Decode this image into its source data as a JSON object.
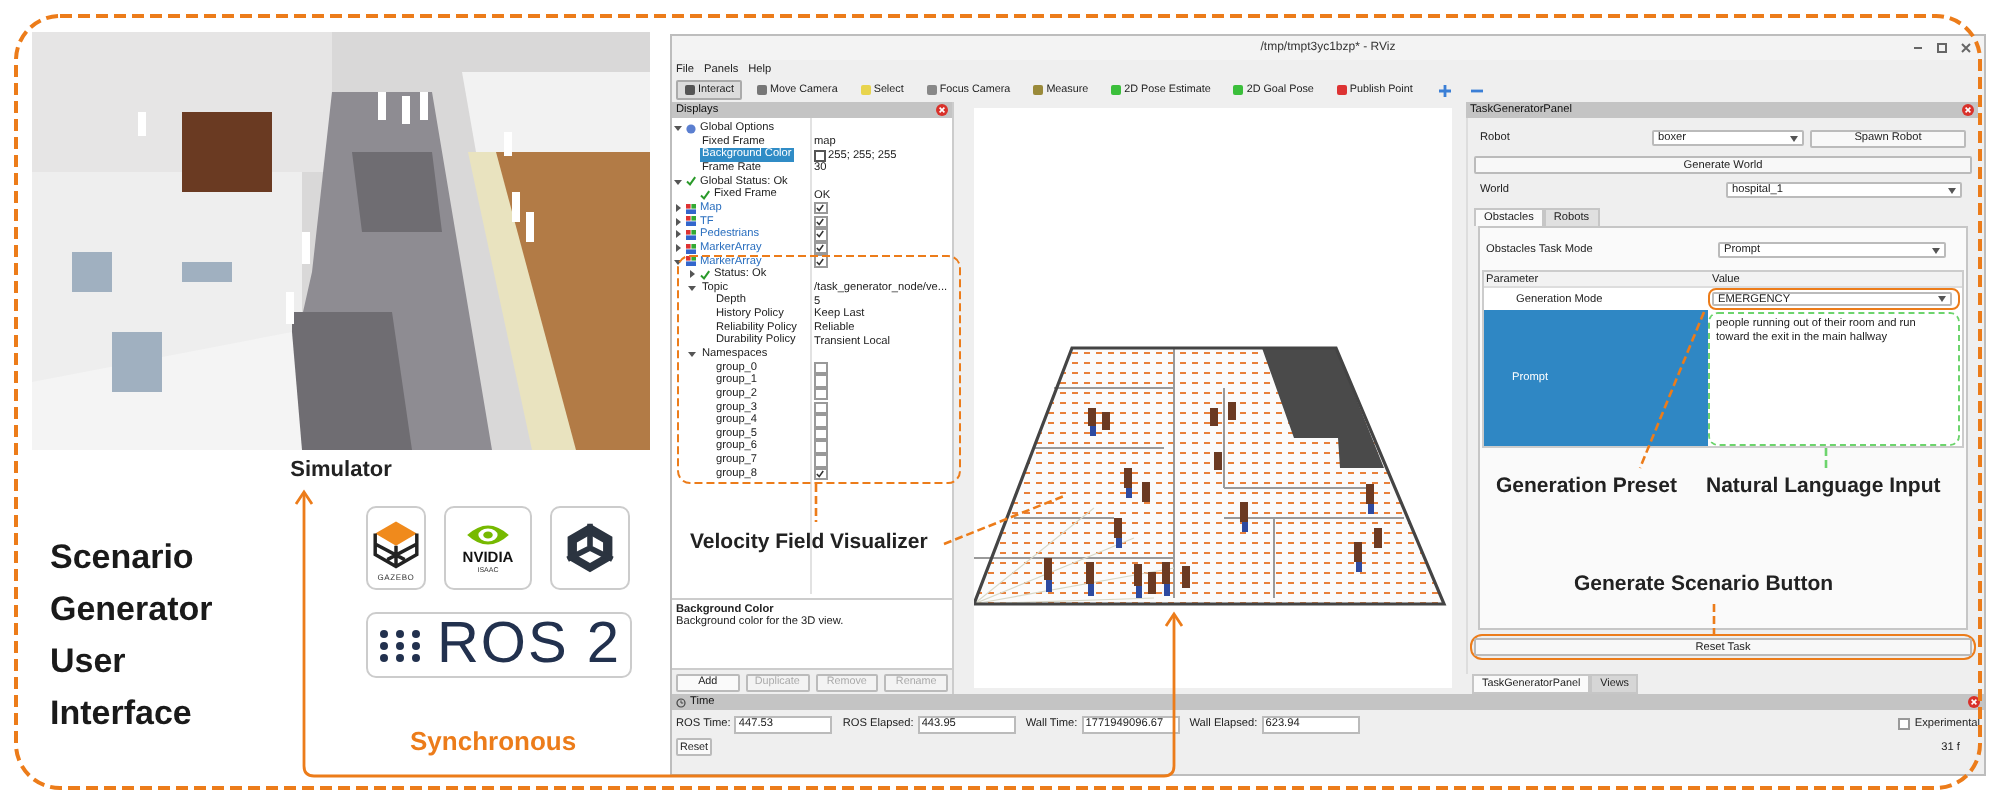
{
  "simulator": {
    "kind": "picture",
    "caption": "Simulator"
  },
  "heading": "Scenario Generator User Interface",
  "logos": [
    {
      "kind": "gazebo",
      "text": "GAZEBO"
    },
    {
      "kind": "nvidia",
      "text": "NVIDIA",
      "subtext": "ISAAC"
    },
    {
      "kind": "unity"
    },
    {
      "kind": "ros",
      "text": "ROS 2"
    }
  ],
  "sync_label": "Synchronous",
  "rviz": {
    "title": "/tmp/tmpt3yc1bzp* - RViz",
    "menu": [
      "File",
      "Panels",
      "Help"
    ],
    "toolbar": [
      {
        "label": "Interact",
        "selected": true
      },
      {
        "label": "Move Camera",
        "selected": false
      },
      {
        "label": "Select",
        "selected": false
      },
      {
        "label": "Focus Camera",
        "selected": false
      },
      {
        "label": "Measure",
        "selected": false
      },
      {
        "label": "2D Pose Estimate",
        "selected": false
      },
      {
        "label": "2D Goal Pose",
        "selected": false
      },
      {
        "label": "Publish Point",
        "selected": false
      }
    ],
    "displays": {
      "title": "Displays",
      "tree": [
        {
          "kind": "options",
          "name": "Global Options",
          "expanded": true,
          "selected": false,
          "children": [
            {
              "kind": "property",
              "name": "Fixed Frame",
              "value": "map",
              "selected": false
            },
            {
              "kind": "color",
              "name": "Background Color",
              "value": "255; 255; 255",
              "selected": true
            },
            {
              "kind": "property",
              "name": "Frame Rate",
              "value": "30",
              "selected": false
            }
          ]
        },
        {
          "kind": "status",
          "name": "Global Status: Ok",
          "expanded": true,
          "selected": false,
          "children": [
            {
              "kind": "status",
              "name": "Fixed Frame",
              "value": "OK",
              "selected": false
            }
          ]
        },
        {
          "kind": "display",
          "name": "Map",
          "expanded": false,
          "checked": true,
          "selected": false
        },
        {
          "kind": "display",
          "name": "TF",
          "expanded": false,
          "checked": true,
          "selected": false
        },
        {
          "kind": "display",
          "name": "Pedestrians",
          "expanded": false,
          "checked": true,
          "selected": false
        },
        {
          "kind": "display",
          "name": "MarkerArray",
          "expanded": false,
          "checked": true,
          "selected": false
        },
        {
          "kind": "display",
          "name": "MarkerArray",
          "expanded": true,
          "checked": true,
          "selected": false,
          "children": [
            {
              "kind": "status",
              "name": "Status: Ok",
              "expanded": false,
              "selected": false
            },
            {
              "kind": "property",
              "name": "Topic",
              "value": "/task_generator_node/ve...",
              "expanded": true,
              "selected": false,
              "children": [
                {
                  "kind": "property",
                  "name": "Depth",
                  "value": "5",
                  "selected": false
                },
                {
                  "kind": "property",
                  "name": "History Policy",
                  "value": "Keep Last",
                  "selected": false
                },
                {
                  "kind": "property",
                  "name": "Reliability Policy",
                  "value": "Reliable",
                  "selected": false
                },
                {
                  "kind": "property",
                  "name": "Durability Policy",
                  "value": "Transient Local",
                  "selected": false
                }
              ]
            },
            {
              "kind": "property",
              "name": "Namespaces",
              "expanded": true,
              "selected": false,
              "children": [
                {
                  "kind": "property",
                  "name": "group_0",
                  "checked": false,
                  "selected": false
                },
                {
                  "kind": "property",
                  "name": "group_1",
                  "checked": false,
                  "selected": false
                },
                {
                  "kind": "property",
                  "name": "group_2",
                  "checked": false,
                  "selected": false
                },
                {
                  "kind": "property",
                  "name": "group_3",
                  "checked": false,
                  "selected": false
                },
                {
                  "kind": "property",
                  "name": "group_4",
                  "checked": false,
                  "selected": false
                },
                {
                  "kind": "property",
                  "name": "group_5",
                  "checked": false,
                  "selected": false
                },
                {
                  "kind": "property",
                  "name": "group_6",
                  "checked": false,
                  "selected": false
                },
                {
                  "kind": "property",
                  "name": "group_7",
                  "checked": false,
                  "selected": false
                },
                {
                  "kind": "property",
                  "name": "group_8",
                  "checked": true,
                  "selected": false
                }
              ]
            }
          ]
        }
      ],
      "description": {
        "title": "Background Color",
        "text": "Background color for the 3D view."
      },
      "buttons": [
        {
          "label": "Add",
          "disabled": false
        },
        {
          "label": "Duplicate",
          "disabled": true
        },
        {
          "label": "Remove",
          "disabled": true
        },
        {
          "label": "Rename",
          "disabled": true
        }
      ]
    },
    "viewport": {
      "kind": "picture"
    },
    "task_panel": {
      "title": "TaskGeneratorPanel",
      "robot_label": "Robot",
      "robot": "boxer",
      "spawn_button": "Spawn Robot",
      "generate_world_button": "Generate World",
      "world_label": "World",
      "world": "hospital_1",
      "tabs": [
        {
          "label": "Obstacles",
          "selected": true
        },
        {
          "label": "Robots",
          "selected": false
        }
      ],
      "task_mode_label": "Obstacles Task Mode",
      "task_mode": "Prompt",
      "columns": [
        "Parameter",
        "Value"
      ],
      "rows": [
        {
          "kind": "dropdown",
          "name": "Generation Mode",
          "value": "EMERGENCY",
          "selected": false
        },
        {
          "kind": "text",
          "name": "Prompt",
          "value": "people running out of their room and run toward the exit in the main hallway",
          "selected": true
        }
      ],
      "reset_button": "Reset Task"
    },
    "dock_tabs": [
      {
        "label": "TaskGeneratorPanel",
        "selected": true
      },
      {
        "label": "Views",
        "selected": false
      }
    ],
    "time_panel": {
      "title": "Time",
      "fields": [
        {
          "label": "ROS Time:",
          "value": "447.53"
        },
        {
          "label": "ROS Elapsed:",
          "value": "443.95"
        },
        {
          "label": "Wall Time:",
          "value": "1771949096.67"
        },
        {
          "label": "Wall Elapsed:",
          "value": "623.94"
        }
      ],
      "experimental": {
        "label": "Experimental",
        "checked": false
      },
      "reset_button": "Reset",
      "fps": "31 f"
    }
  },
  "annotations": {
    "velocity": "Velocity Field Visualizer",
    "preset": "Generation Preset",
    "language": "Natural Language Input",
    "generate": "Generate Scenario Button"
  }
}
